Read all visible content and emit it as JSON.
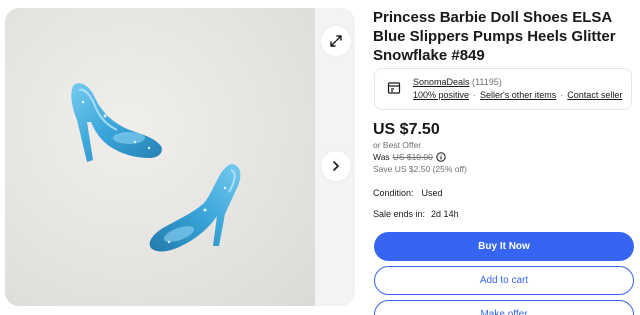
{
  "item": {
    "title": "Princess Barbie Doll Shoes ELSA Blue Slippers Pumps Heels Glitter Snowflake #849"
  },
  "seller": {
    "name": "SonomaDeals",
    "feedback_count": "(11195)",
    "positive": "100% positive",
    "other_items": "Seller's other items",
    "contact": "Contact seller"
  },
  "pricing": {
    "price": "US $7.50",
    "best_offer": "or Best Offer",
    "was_label": "Was",
    "was_price": "US $10.00",
    "save": "Save US $2.50 (25% off)"
  },
  "details": {
    "condition_label": "Condition:",
    "condition_value": "Used",
    "sale_label": "Sale ends in:",
    "sale_value": "2d 14h"
  },
  "actions": {
    "buy_now": "Buy It Now",
    "add_to_cart": "Add to cart",
    "make_offer": "Make offer"
  },
  "gallery": {
    "expand_icon": "expand-icon",
    "next_icon": "chevron-right-icon"
  },
  "colors": {
    "accent": "#3665f3",
    "shoe": "#2a9fd8"
  }
}
